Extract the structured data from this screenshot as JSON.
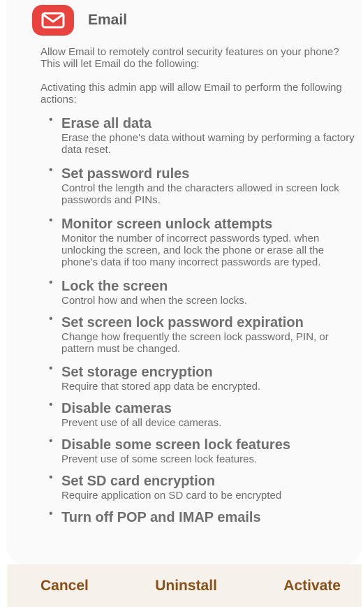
{
  "app": {
    "name": "Email",
    "icon": "envelope-icon",
    "icon_color": "#e8433e"
  },
  "intro": "Allow Email to remotely control security features on your phone?\nThis will let Email do the following:",
  "lead": "Activating this admin app will allow Email to perform the following actions:",
  "permissions": [
    {
      "title": "Erase all data",
      "desc": "Erase the phone's data without warning by performing a factory data reset."
    },
    {
      "title": "Set password rules",
      "desc": "Control the length and the characters allowed in screen lock passwords and PINs."
    },
    {
      "title": "Monitor screen unlock attempts",
      "desc": "Monitor the number of incorrect passwords typed. when unlocking the screen, and lock the phone or erase all the phone's data if too many incorrect passwords are typed."
    },
    {
      "title": "Lock the screen",
      "desc": "Control how and when the screen locks."
    },
    {
      "title": "Set screen lock password expiration",
      "desc": "Change how frequently the screen lock password, PIN, or pattern must be changed."
    },
    {
      "title": "Set storage encryption",
      "desc": "Require that stored app data be encrypted."
    },
    {
      "title": "Disable cameras",
      "desc": "Prevent use of all device cameras."
    },
    {
      "title": "Disable some screen lock features",
      "desc": "Prevent use of some screen lock features."
    },
    {
      "title": "Set SD card encryption",
      "desc": "Require application on SD card to be encrypted"
    },
    {
      "title": "Turn off POP and IMAP emails",
      "desc": ""
    }
  ],
  "bullet": "•",
  "actions": {
    "cancel": "Cancel",
    "uninstall": "Uninstall",
    "activate": "Activate"
  },
  "colors": {
    "action_text": "#8a5016",
    "footer_bg": "#f6f1ea"
  }
}
